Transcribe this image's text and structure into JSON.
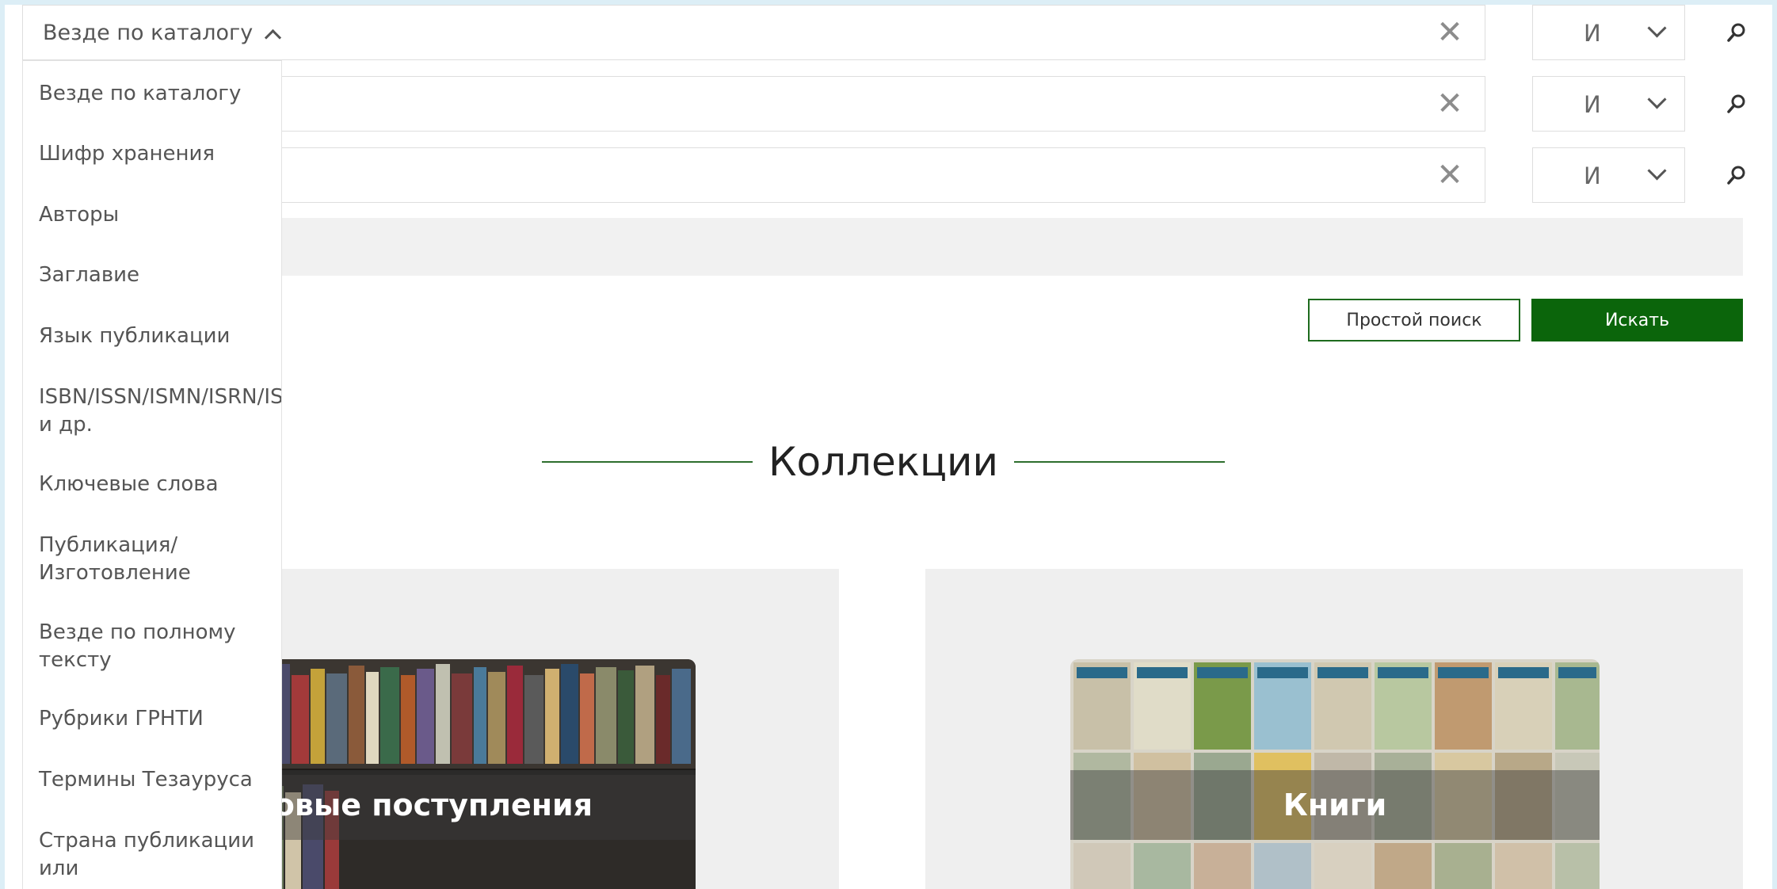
{
  "search": {
    "field_selected": "Везде по каталогу",
    "clear_symbol": "✕",
    "rows": [
      {
        "operator": "И"
      },
      {
        "operator": "И"
      },
      {
        "operator": "И"
      }
    ],
    "field_options": [
      "Везде по каталогу",
      "Шифр хранения",
      "Авторы",
      "Заглавие",
      "Язык публикации",
      "ISBN/ISSN/ISMN/ISRN/IS\nи др.",
      "Ключевые слова",
      "Публикация/\nИзготовление",
      "Везде по полному\nтексту",
      "Рубрики ГРНТИ",
      "Термины Тезауруса",
      "Страна публикации или\nпроизводства"
    ]
  },
  "actions": {
    "simple_search_label": "Простой поиск",
    "search_label": "Искать"
  },
  "collections": {
    "title": "Коллекции",
    "items": [
      {
        "label": "Новые поступления"
      },
      {
        "label": "Книги"
      }
    ]
  },
  "colors": {
    "accent_green": "#0b650b",
    "frame_blue": "#dceef6",
    "panel_gray": "#efefef"
  },
  "icons": {
    "search": "search-icon",
    "clear": "close-icon",
    "dropdown": "chevron-down-icon",
    "dropdown_open": "chevron-up-icon"
  }
}
